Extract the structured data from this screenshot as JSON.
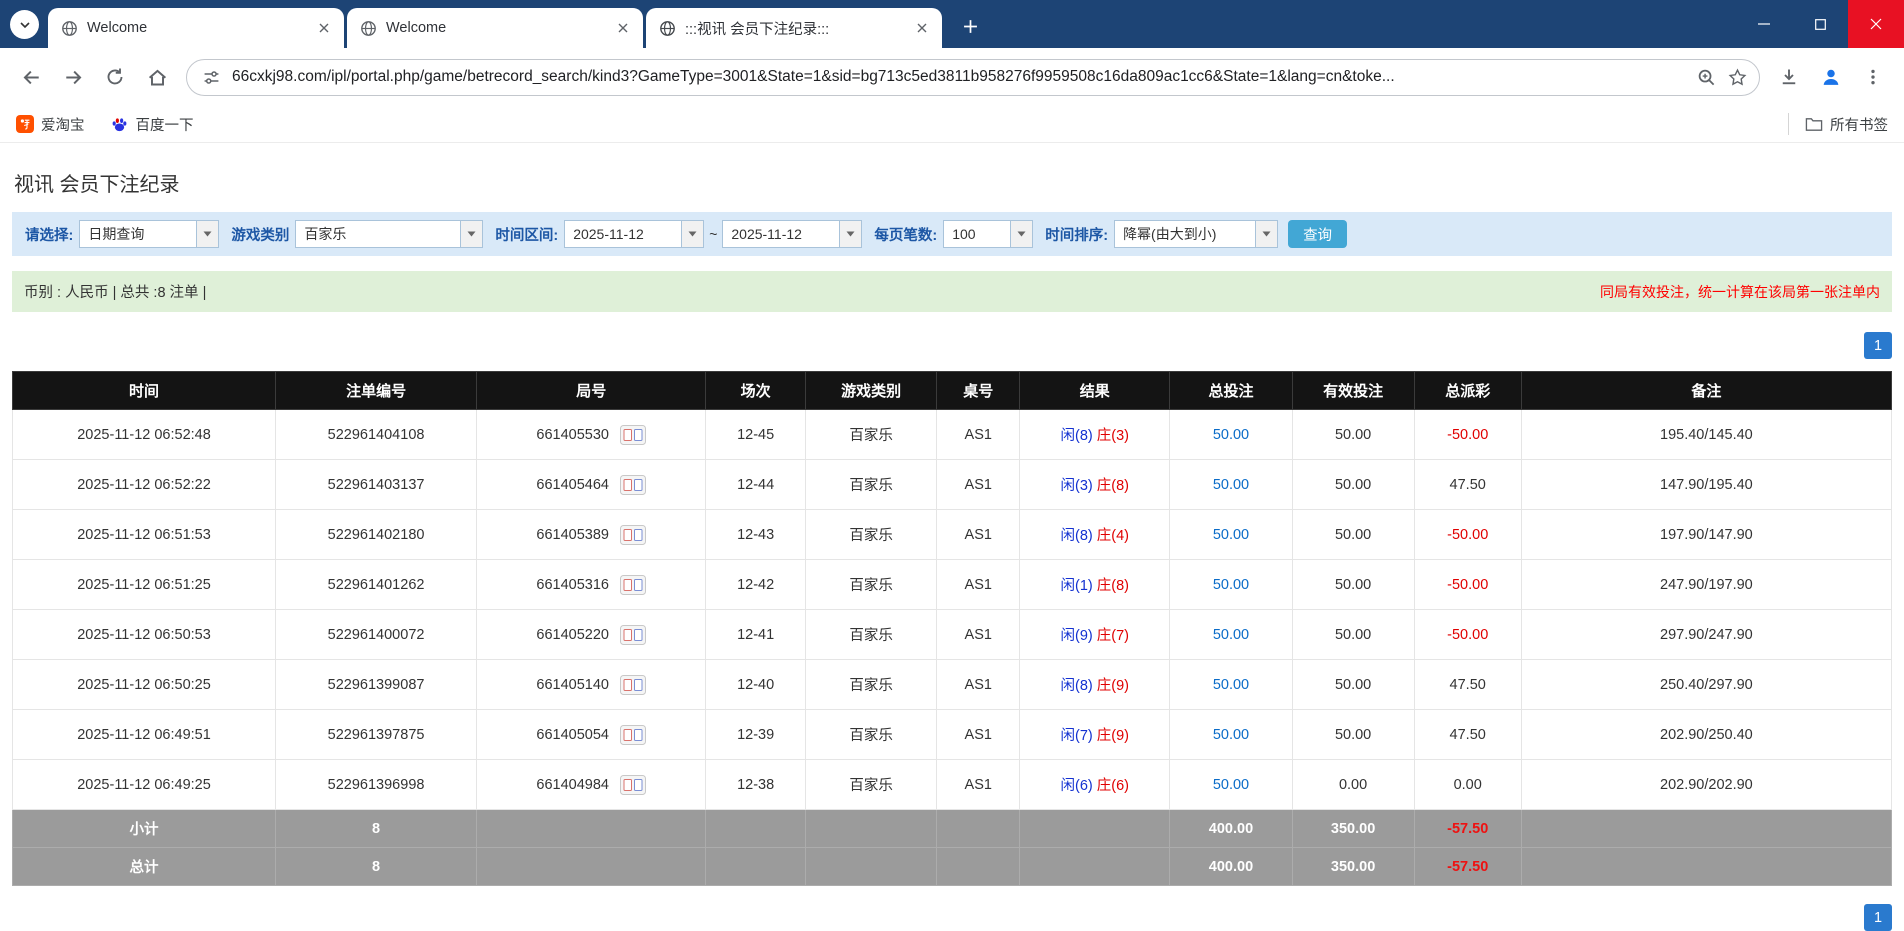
{
  "browser": {
    "tabs": [
      {
        "title": "Welcome"
      },
      {
        "title": "Welcome"
      },
      {
        "title": ":::视讯 会员下注纪录:::"
      }
    ],
    "url": "66cxkj98.com/ipl/portal.php/game/betrecord_search/kind3?GameType=3001&State=1&sid=bg713c5ed3811b958276f9959508c16da809ac1cc6&State=1&lang=cn&toke...",
    "bookmarks": [
      {
        "label": "爱淘宝"
      },
      {
        "label": "百度一下"
      }
    ],
    "all_bookmarks_label": "所有书签"
  },
  "page": {
    "title": "视讯 会员下注纪录",
    "filters": {
      "select_label": "请选择:",
      "select_value": "日期查询",
      "game_label": "游戏类别",
      "game_value": "百家乐",
      "range_label": "时间区间:",
      "range_from": "2025-11-12",
      "range_sep": "~",
      "range_to": "2025-11-12",
      "per_page_label": "每页笔数:",
      "per_page_value": "100",
      "sort_label": "时间排序:",
      "sort_value": "降幂(由大到小)",
      "search_label": "查询"
    },
    "summary": {
      "left": "币别 : 人民币 | 总共 :8 注单 |",
      "right": "同局有效投注，统一计算在该局第一张注单内"
    },
    "pagination_label": "1",
    "table": {
      "headers": [
        "时间",
        "注单编号",
        "局号",
        "场次",
        "游戏类别",
        "桌号",
        "结果",
        "总投注",
        "有效投注",
        "总派彩",
        "备注"
      ],
      "rows": [
        {
          "time": "2025-11-12 06:52:48",
          "bet_id": "522961404108",
          "round_id": "661405530",
          "session": "12-45",
          "game": "百家乐",
          "table": "AS1",
          "player": "闲(8)",
          "banker": "庄(3)",
          "total_bet": "50.00",
          "valid_bet": "50.00",
          "payout": "-50.00",
          "note": "195.40/145.40"
        },
        {
          "time": "2025-11-12 06:52:22",
          "bet_id": "522961403137",
          "round_id": "661405464",
          "session": "12-44",
          "game": "百家乐",
          "table": "AS1",
          "player": "闲(3)",
          "banker": "庄(8)",
          "total_bet": "50.00",
          "valid_bet": "50.00",
          "payout": "47.50",
          "note": "147.90/195.40"
        },
        {
          "time": "2025-11-12 06:51:53",
          "bet_id": "522961402180",
          "round_id": "661405389",
          "session": "12-43",
          "game": "百家乐",
          "table": "AS1",
          "player": "闲(8)",
          "banker": "庄(4)",
          "total_bet": "50.00",
          "valid_bet": "50.00",
          "payout": "-50.00",
          "note": "197.90/147.90"
        },
        {
          "time": "2025-11-12 06:51:25",
          "bet_id": "522961401262",
          "round_id": "661405316",
          "session": "12-42",
          "game": "百家乐",
          "table": "AS1",
          "player": "闲(1)",
          "banker": "庄(8)",
          "total_bet": "50.00",
          "valid_bet": "50.00",
          "payout": "-50.00",
          "note": "247.90/197.90"
        },
        {
          "time": "2025-11-12 06:50:53",
          "bet_id": "522961400072",
          "round_id": "661405220",
          "session": "12-41",
          "game": "百家乐",
          "table": "AS1",
          "player": "闲(9)",
          "banker": "庄(7)",
          "total_bet": "50.00",
          "valid_bet": "50.00",
          "payout": "-50.00",
          "note": "297.90/247.90"
        },
        {
          "time": "2025-11-12 06:50:25",
          "bet_id": "522961399087",
          "round_id": "661405140",
          "session": "12-40",
          "game": "百家乐",
          "table": "AS1",
          "player": "闲(8)",
          "banker": "庄(9)",
          "total_bet": "50.00",
          "valid_bet": "50.00",
          "payout": "47.50",
          "note": "250.40/297.90"
        },
        {
          "time": "2025-11-12 06:49:51",
          "bet_id": "522961397875",
          "round_id": "661405054",
          "session": "12-39",
          "game": "百家乐",
          "table": "AS1",
          "player": "闲(7)",
          "banker": "庄(9)",
          "total_bet": "50.00",
          "valid_bet": "50.00",
          "payout": "47.50",
          "note": "202.90/250.40"
        },
        {
          "time": "2025-11-12 06:49:25",
          "bet_id": "522961396998",
          "round_id": "661404984",
          "session": "12-38",
          "game": "百家乐",
          "table": "AS1",
          "player": "闲(6)",
          "banker": "庄(6)",
          "total_bet": "50.00",
          "valid_bet": "0.00",
          "payout": "0.00",
          "note": "202.90/202.90"
        }
      ],
      "subtotal": {
        "label": "小计",
        "count": "8",
        "total_bet": "400.00",
        "valid_bet": "350.00",
        "payout": "-57.50"
      },
      "total": {
        "label": "总计",
        "count": "8",
        "total_bet": "400.00",
        "valid_bet": "350.00",
        "payout": "-57.50"
      }
    },
    "colors": {
      "accent_blue": "#2a7ace",
      "link_blue": "#0a6cc8",
      "result_player_blue": "#1331d1",
      "result_banker_red": "#e00000",
      "negative_red": "#ee1111",
      "filter_bg": "#d9e9f8",
      "summary_bg": "#dff0d8",
      "header_bg": "#141414",
      "footer_bg": "#9b9b9b"
    }
  }
}
